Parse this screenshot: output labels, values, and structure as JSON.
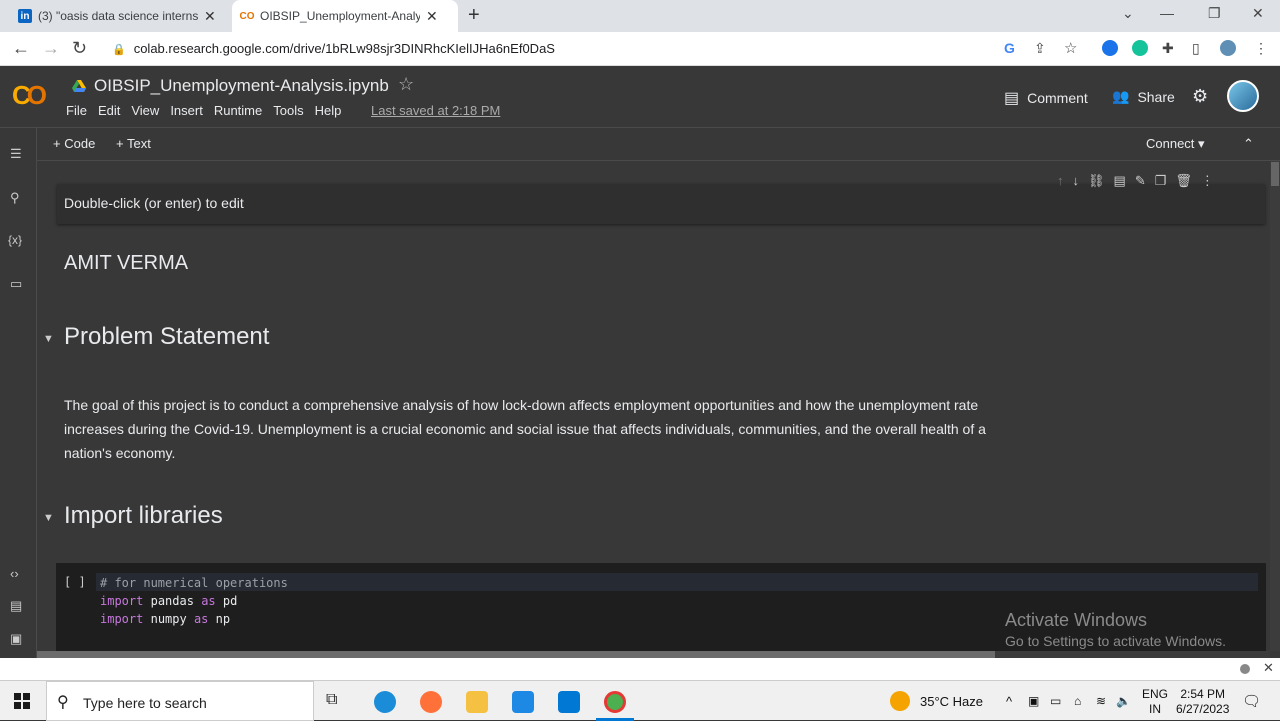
{
  "browser": {
    "tabs": [
      {
        "title": "(3) \"oasis data science internship",
        "favicon": "in",
        "active": false
      },
      {
        "title": "OIBSIP_Unemployment-Analysis.",
        "favicon": "CO",
        "active": true
      }
    ],
    "url": "colab.research.google.com/drive/1bRLw98sjr3DINRhcKIelIJHa6nEf0DaS"
  },
  "colab": {
    "notebook_title": "OIBSIP_Unemployment-Analysis.ipynb",
    "menu": [
      "File",
      "Edit",
      "View",
      "Insert",
      "Runtime",
      "Tools",
      "Help"
    ],
    "last_saved": "Last saved at 2:18 PM",
    "comment_label": "Comment",
    "share_label": "Share",
    "add_code": "Code",
    "add_text": "Text",
    "connect_label": "Connect"
  },
  "notebook": {
    "edit_hint": "Double-click (or enter) to edit",
    "author": "AMIT VERMA",
    "section1_title": "Problem Statement",
    "section1_text": "The goal of this project is to conduct a comprehensive analysis of how lock-down affects employment opportunities and how the unemployment rate increases during the Covid-19. Unemployment is a crucial economic and social issue that affects individuals, communities, and the overall health of a nation's economy.",
    "section2_title": "Import libraries",
    "run_indicator": "[ ]",
    "code": {
      "comment": "# for numerical operations",
      "line2": {
        "kw": "import",
        "mod": "pandas",
        "as": "as",
        "alias": "pd"
      },
      "line3": {
        "kw": "import",
        "mod": "numpy",
        "as": "as",
        "alias": "np"
      }
    }
  },
  "watermark": {
    "line1": "Activate Windows",
    "line2": "Go to Settings to activate Windows."
  },
  "taskbar": {
    "search_placeholder": "Type here to search",
    "weather": "35°C  Haze",
    "lang": "ENG",
    "region": "IN",
    "time": "2:54 PM",
    "date": "6/27/2023"
  }
}
